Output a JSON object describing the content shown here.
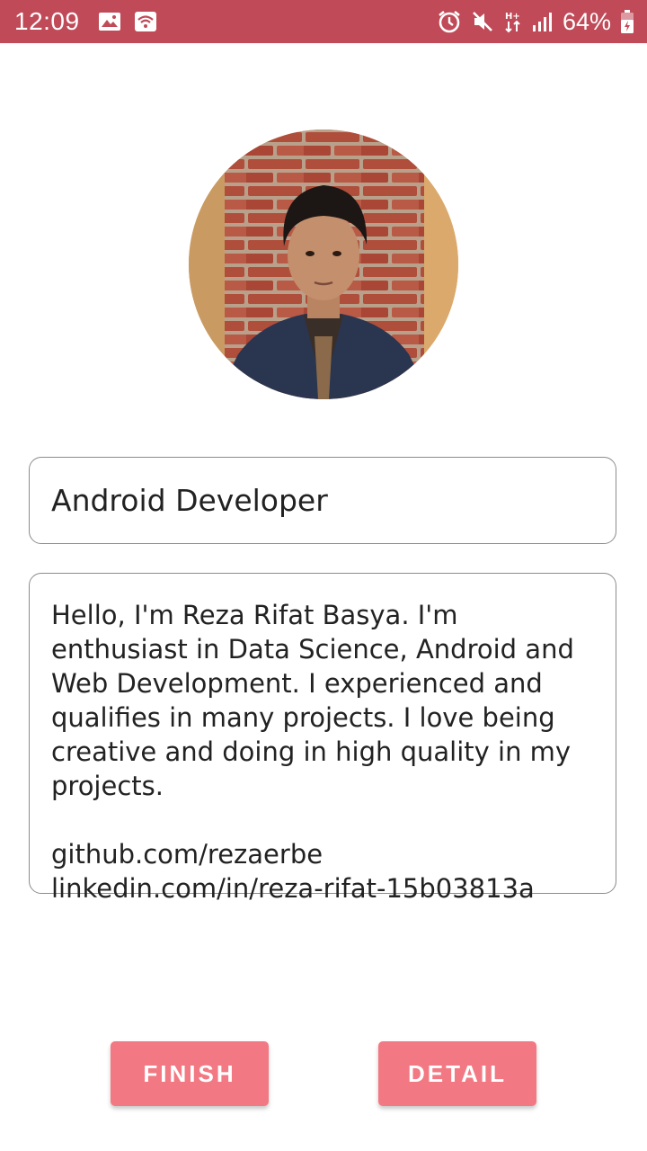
{
  "status_bar": {
    "time": "12:09",
    "battery_percent": "64%",
    "left_icons": [
      "image-icon",
      "wifi-hotspot-icon"
    ],
    "right_icons": [
      "alarm-icon",
      "mute-icon",
      "data-transfer-icon",
      "signal-icon",
      "battery-icon"
    ],
    "background_color": "#c04a58"
  },
  "profile": {
    "role": "Android Developer",
    "bio": "Hello, I'm Reza Rifat Basya. I'm enthusiast in Data Science, Android and Web Development. I experienced and qualifies in many projects. I love being creative and doing in high quality in my projects.",
    "links": {
      "github": "github.com/rezaerbe",
      "linkedin": "linkedin.com/in/reza-rifat-15b03813a"
    }
  },
  "buttons": {
    "finish_label": "FINISH",
    "detail_label": "DETAIL",
    "color": "#f27983"
  }
}
